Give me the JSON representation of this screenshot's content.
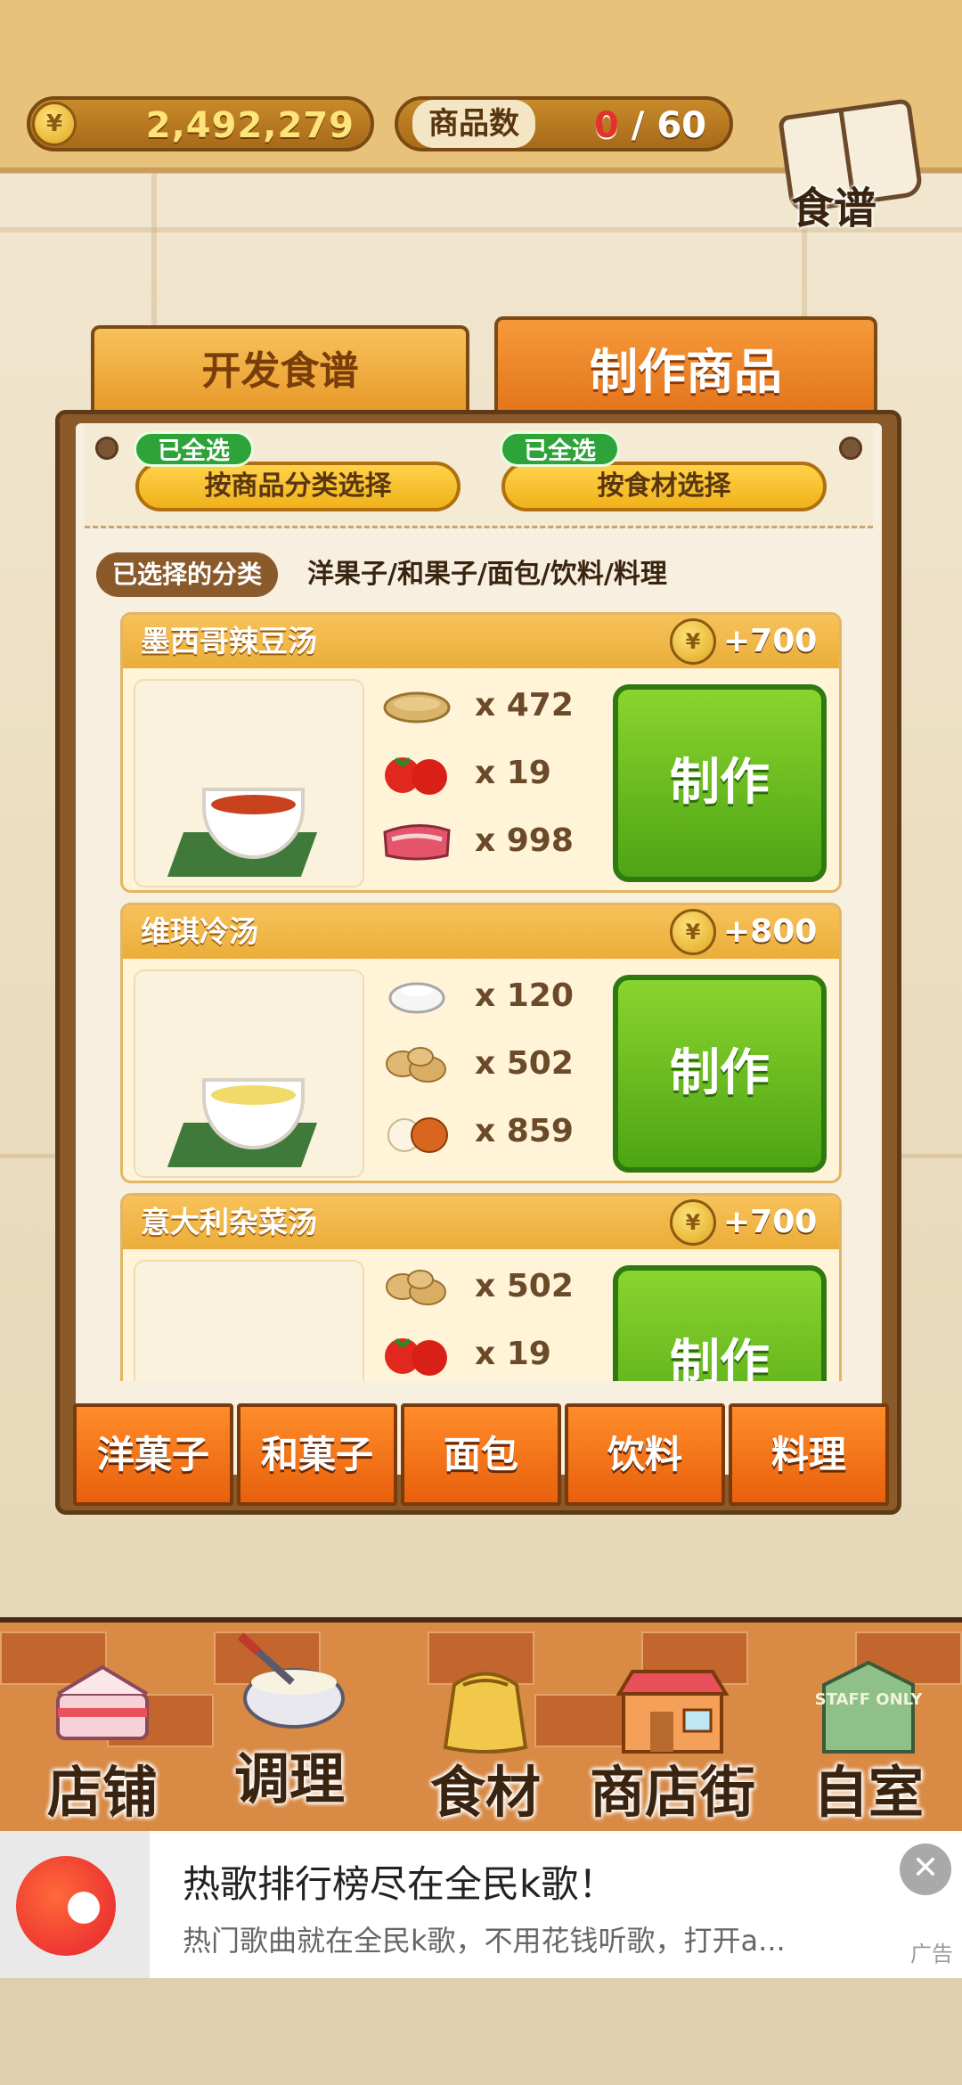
{
  "hud": {
    "coins": "2,492,279",
    "coin_symbol": "¥",
    "items_label": "商品数",
    "items_current": "0",
    "items_separator": "/",
    "items_max": "60",
    "recipe_book_label": "食谱"
  },
  "tabs": [
    {
      "label": "开发食谱",
      "active": false
    },
    {
      "label": "制作商品",
      "active": true
    }
  ],
  "filters": {
    "by_category": {
      "badge": "已全选",
      "label": "按商品分类选择"
    },
    "by_ingredient": {
      "badge": "已全选",
      "label": "按食材选择"
    }
  },
  "selected_category": {
    "tag": "已选择的分类",
    "value": "洋果子/和果子/面包/饮料/料理"
  },
  "recipes": [
    {
      "name": "墨西哥辣豆汤",
      "price": "+700",
      "ingredients": [
        {
          "icon": "beans-icon",
          "qty": "x 472"
        },
        {
          "icon": "tomato-icon",
          "qty": "x 19"
        },
        {
          "icon": "meat-icon",
          "qty": "x 998"
        }
      ],
      "button": "制作"
    },
    {
      "name": "维琪冷汤",
      "price": "+800",
      "ingredients": [
        {
          "icon": "salt-icon",
          "qty": "x 120"
        },
        {
          "icon": "potato-icon",
          "qty": "x 502"
        },
        {
          "icon": "onion-icon",
          "qty": "x 859"
        }
      ],
      "button": "制作"
    },
    {
      "name": "意大利杂菜汤",
      "price": "+700",
      "ingredients": [
        {
          "icon": "potato-icon",
          "qty": "x 502"
        },
        {
          "icon": "tomato-icon",
          "qty": "x 19"
        }
      ],
      "button": "制作"
    }
  ],
  "categories": [
    "洋菓子",
    "和菓子",
    "面包",
    "饮料",
    "料理"
  ],
  "bottom_nav": [
    {
      "label": "店铺",
      "icon": "cake-icon"
    },
    {
      "label": "调理",
      "icon": "whisk-bowl-icon"
    },
    {
      "label": "食材",
      "icon": "flour-sack-icon"
    },
    {
      "label": "商店街",
      "icon": "storefront-icon"
    },
    {
      "label": "自室",
      "icon": "staff-only-sign-icon"
    }
  ],
  "staff_sign_text": "STAFF ONLY",
  "ad": {
    "title": "热歌排行榜尽在全民k歌！",
    "description": "热门歌曲就在全民k歌，不用花钱听歌，打开a...",
    "tag": "广告",
    "close": "✕"
  },
  "colors": {
    "accent_orange": "#e8600c",
    "make_green": "#4ea414",
    "coin_gold": "#ffe47a",
    "wood_brown": "#8b5a2b"
  }
}
